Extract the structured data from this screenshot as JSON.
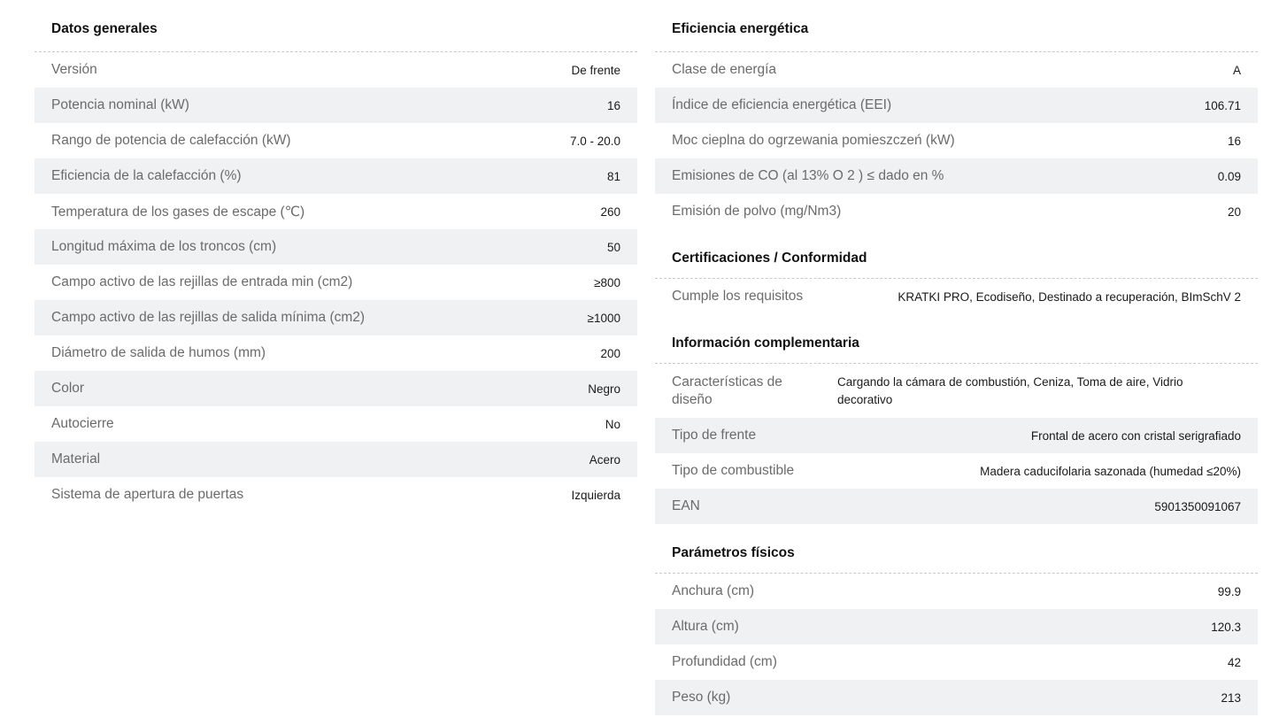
{
  "left": {
    "title": "Datos generales",
    "rows": [
      {
        "label": "Versión",
        "value": "De frente"
      },
      {
        "label": "Potencia nominal (kW)",
        "value": "16"
      },
      {
        "label": "Rango de potencia de calefacción (kW)",
        "value": "7.0 - 20.0"
      },
      {
        "label": "Eficiencia de la calefacción (%)",
        "value": "81"
      },
      {
        "label": "Temperatura de los gases de escape (℃)",
        "value": "260"
      },
      {
        "label": "Longitud máxima de los troncos (cm)",
        "value": "50"
      },
      {
        "label": "Campo activo de las rejillas de entrada min (cm2)",
        "value": "≥800"
      },
      {
        "label": "Campo activo de las rejillas de salida mínima (cm2)",
        "value": "≥1000"
      },
      {
        "label": "Diámetro de salida de humos (mm)",
        "value": "200"
      },
      {
        "label": "Color",
        "value": "Negro"
      },
      {
        "label": "Autocierre",
        "value": "No"
      },
      {
        "label": "Material",
        "value": "Acero"
      },
      {
        "label": "Sistema de apertura de puertas",
        "value": "Izquierda"
      }
    ]
  },
  "energy": {
    "title": "Eficiencia energética",
    "rows": [
      {
        "label": "Clase de energía",
        "value": "A"
      },
      {
        "label": "Índice de eficiencia energética (EEI)",
        "value": "106.71"
      },
      {
        "label": "Moc cieplna do ogrzewania pomieszczeń (kW)",
        "value": "16"
      },
      {
        "label": "Emisiones de CO (al 13% O 2 ) ≤ dado en %",
        "value": "0.09"
      },
      {
        "label": "Emisión de polvo (mg/Nm3)",
        "value": "20"
      }
    ]
  },
  "certs": {
    "title": "Certificaciones / Conformidad",
    "rows": [
      {
        "label": "Cumple los requisitos",
        "value": "KRATKI PRO, Ecodiseño, Destinado a recuperación, BImSchV 2"
      }
    ]
  },
  "extra": {
    "title": "Información complementaria",
    "rows": [
      {
        "label": "Características de diseño",
        "value": "Cargando la cámara de combustión, Ceniza, Toma de aire, Vidrio decorativo"
      },
      {
        "label": "Tipo de frente",
        "value": "Frontal de acero con cristal serigrafiado"
      },
      {
        "label": "Tipo de combustible",
        "value": "Madera caducifolaria sazonada (humedad ≤20%)"
      },
      {
        "label": "EAN",
        "value": "5901350091067"
      }
    ]
  },
  "physical": {
    "title": "Parámetros físicos",
    "rows": [
      {
        "label": "Anchura (cm)",
        "value": "99.9"
      },
      {
        "label": "Altura (cm)",
        "value": "120.3"
      },
      {
        "label": "Profundidad (cm)",
        "value": "42"
      },
      {
        "label": "Peso (kg)",
        "value": "213"
      }
    ]
  }
}
